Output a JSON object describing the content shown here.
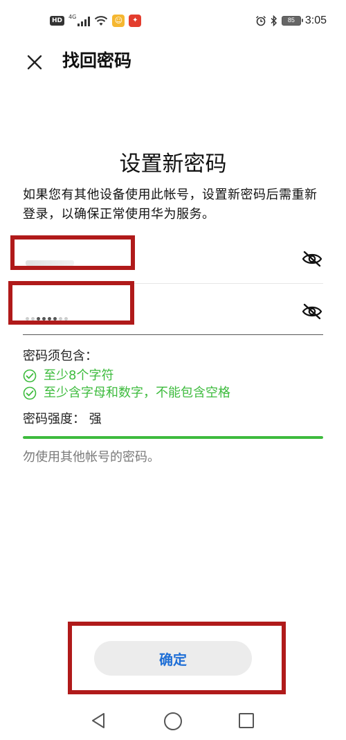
{
  "status_bar": {
    "hd_badge": "HD",
    "network": "4G",
    "battery": "85",
    "time": "3:05"
  },
  "header": {
    "close_icon": "close-icon",
    "title": "找回密码"
  },
  "main": {
    "title": "设置新密码",
    "description": "如果您有其他设备使用此帐号，设置新密码后需重新登录，以确保正常使用华为服务。",
    "password_fields": [
      {
        "toggle_icon": "eye-off-icon"
      },
      {
        "toggle_icon": "eye-off-icon"
      }
    ],
    "requirements": {
      "title": "密码须包含：",
      "items": [
        {
          "text": "至少8个字符",
          "icon": "check-circle-icon"
        },
        {
          "text": "至少含字母和数字，不能包含空格",
          "icon": "check-circle-icon"
        }
      ]
    },
    "strength": {
      "label": "密码强度：",
      "value": "强",
      "level": 1.0,
      "color": "#3dbb3d"
    },
    "hint": "勿使用其他帐号的密码。"
  },
  "confirm_button": {
    "label": "确定",
    "text_color": "#1f6fd6"
  },
  "colors": {
    "accent_green": "#3dbb3d",
    "annotation_red": "#b01a1a"
  }
}
